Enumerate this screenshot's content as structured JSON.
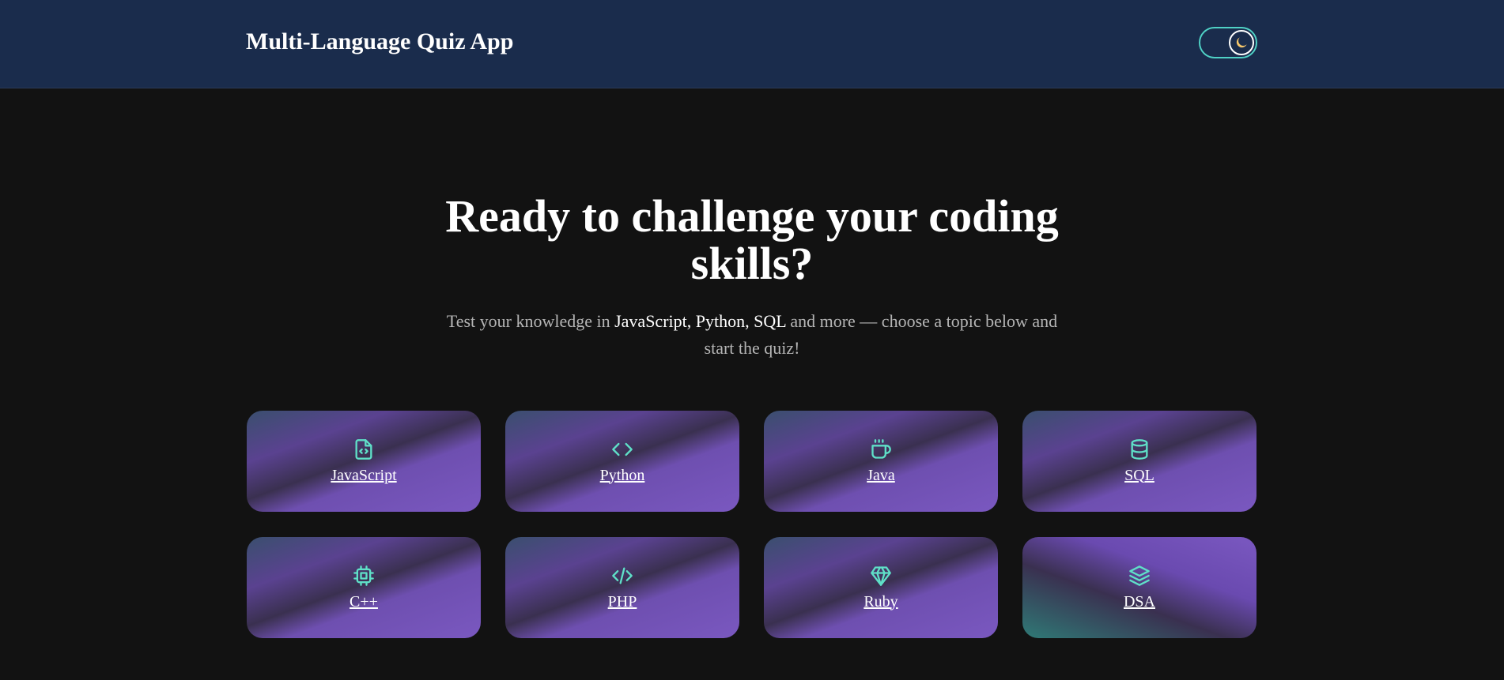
{
  "header": {
    "title": "Multi-Language Quiz App",
    "theme_toggle_icon": "moon-icon"
  },
  "hero": {
    "title": "Ready to challenge your coding skills?",
    "subtitle_prefix": "Test your knowledge in ",
    "subtitle_highlight": "JavaScript, Python, SQL",
    "subtitle_suffix": " and more — choose a topic below and start the quiz!"
  },
  "topics": [
    {
      "label": "JavaScript",
      "icon": "file-code-icon"
    },
    {
      "label": "Python",
      "icon": "code-icon"
    },
    {
      "label": "Java",
      "icon": "coffee-icon"
    },
    {
      "label": "SQL",
      "icon": "database-icon"
    },
    {
      "label": "C++",
      "icon": "cpu-icon"
    },
    {
      "label": "PHP",
      "icon": "code-slash-icon"
    },
    {
      "label": "Ruby",
      "icon": "gem-icon"
    },
    {
      "label": "DSA",
      "icon": "layers-icon"
    }
  ],
  "colors": {
    "header_bg": "#1a2c4c",
    "page_bg": "#121212",
    "accent": "#4fd1c5",
    "card_purple": "#7a58c0"
  }
}
